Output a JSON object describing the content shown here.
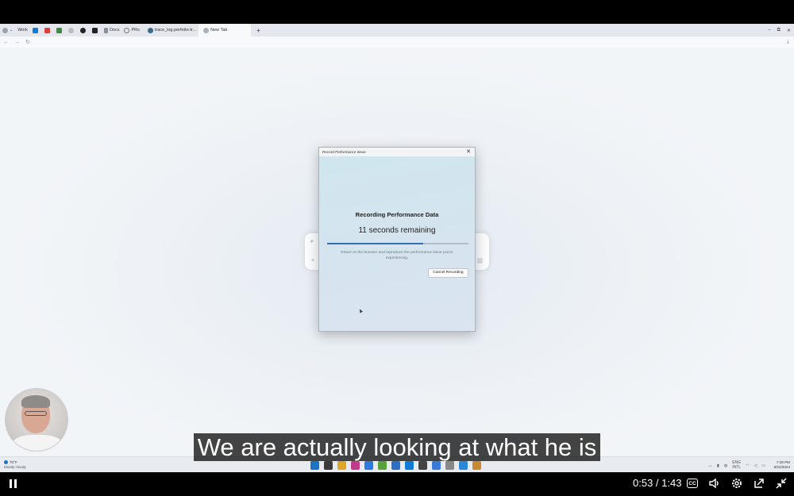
{
  "browser": {
    "favorites": [
      {
        "label": "Work",
        "icon": "work-profile-icon"
      },
      {
        "label": "",
        "icon": "outlook-icon",
        "color": "#0f7bd8"
      },
      {
        "label": "",
        "icon": "gmail-icon",
        "color": "#d9413a"
      },
      {
        "label": "",
        "icon": "puzzle-icon",
        "color": "#3b8a3e"
      },
      {
        "label": "",
        "icon": "refresh-icon",
        "color": "#777777"
      },
      {
        "label": "",
        "icon": "github-icon",
        "color": "#222222"
      },
      {
        "label": "",
        "icon": "notion-icon",
        "color": "#222222"
      },
      {
        "label": "Docs",
        "icon": "docs-icon"
      },
      {
        "label": "PRs",
        "icon": "pr-icon"
      }
    ],
    "tabs": [
      {
        "label": "trace_log.perfetto-tr...",
        "active": false
      },
      {
        "label": "New Tab",
        "active": true
      }
    ],
    "new_tab_symbol": "+",
    "window_controls": [
      "–",
      "⧉",
      "✕"
    ],
    "nav": {
      "back": "←",
      "forward": "→",
      "reload": "↻",
      "download": "⤓"
    }
  },
  "newtab": {
    "search_icon": "⌕",
    "add_symbol": "+"
  },
  "dialog": {
    "title": "Record Performance Issue",
    "close": "✕",
    "heading": "Recording Performance Data",
    "remaining": "11 seconds remaining",
    "progress_fraction": 0.68,
    "message": "Return to the browser and reproduce the performance issue you're experiencing.",
    "cancel_label": "Cancel Recording"
  },
  "taskbar": {
    "weather_temp": "70°F",
    "weather_desc": "Mostly cloudy",
    "apps": [
      "#1a73c9",
      "#3a3a3a",
      "#e3a526",
      "#c23a8a",
      "#2c7be5",
      "#5aa03c",
      "#2b6fc4",
      "#0f7bd8",
      "#444444",
      "#3a7ad9",
      "#888888",
      "#2b88d8",
      "#c98a2d"
    ],
    "lang_line1": "ENG",
    "lang_line2": "INTL",
    "time": "7:29 PM",
    "date": "8/24/2024"
  },
  "caption": "We are actually looking at what he is",
  "player": {
    "time": "0:53 / 1:43",
    "cc_label": "CC"
  }
}
